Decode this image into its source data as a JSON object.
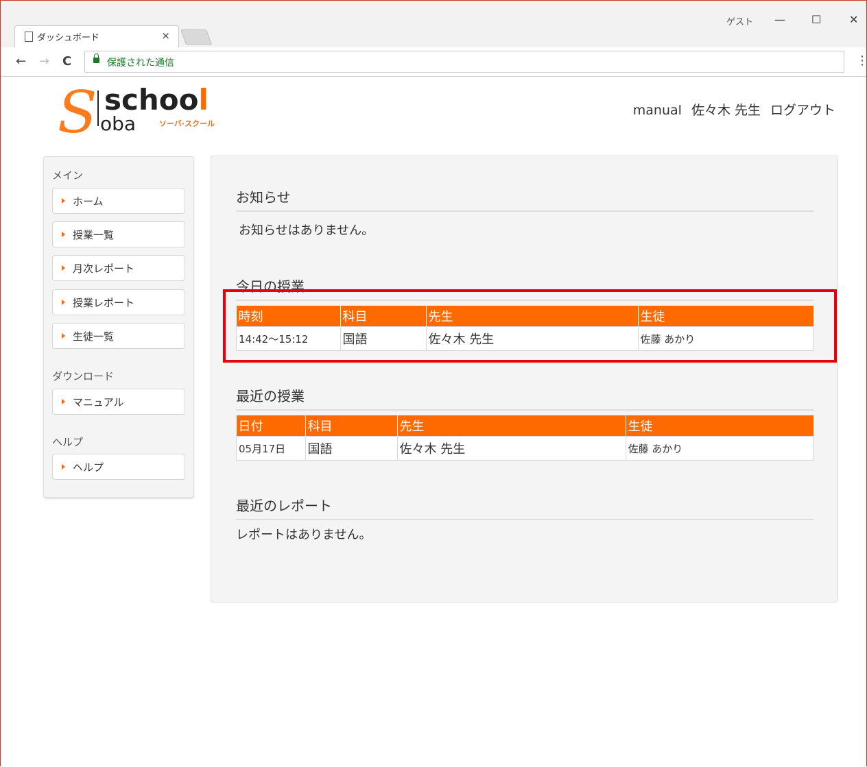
{
  "browser": {
    "tab_title": "ダッシュボード",
    "tab_close": "×",
    "profile": "ゲスト",
    "window_controls": [
      "—",
      "☐",
      "✕"
    ],
    "nav": {
      "back": "←",
      "forward": "→",
      "reload": "C"
    },
    "secure_label": "保護された通信",
    "menu": "⋮"
  },
  "logo": {
    "s": "S",
    "school": "schoo",
    "school_l": "l",
    "oba": "oba",
    "kana": "ソーバ·スクール"
  },
  "topnav": {
    "manual": "manual",
    "user": "佐々木 先生",
    "logout": "ログアウト"
  },
  "sidebar": {
    "main_heading": "メイン",
    "main_items": [
      "ホーム",
      "授業一覧",
      "月次レポート",
      "授業レポート",
      "生徒一覧"
    ],
    "download_heading": "ダウンロード",
    "download_items": [
      "マニュアル"
    ],
    "help_heading": "ヘルプ",
    "help_items": [
      "ヘルプ"
    ]
  },
  "notices": {
    "title": "お知らせ",
    "empty": "お知らせはありません。"
  },
  "today": {
    "title": "今日の授業",
    "headers": [
      "時刻",
      "科目",
      "先生",
      "生徒"
    ],
    "rows": [
      [
        "14:42〜15:12",
        "国語",
        "佐々木 先生",
        "佐藤 あかり"
      ]
    ]
  },
  "recent": {
    "title": "最近の授業",
    "headers": [
      "日付",
      "科目",
      "先生",
      "生徒"
    ],
    "rows": [
      [
        "05月17日",
        "国語",
        "佐々木 先生",
        "佐藤 あかり"
      ]
    ]
  },
  "reports": {
    "title": "最近のレポート",
    "empty": "レポートはありません。"
  },
  "colors": {
    "accent": "#ff6a00",
    "highlight": "#e8000d",
    "secure": "#1b7a2a"
  }
}
